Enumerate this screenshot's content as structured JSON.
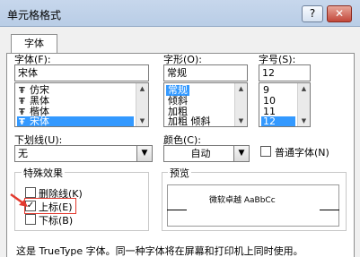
{
  "window": {
    "title": "单元格格式",
    "help_label": "?",
    "close_label": "✕"
  },
  "tabs": [
    {
      "label": "字体"
    }
  ],
  "font": {
    "label": "字体(F):",
    "value": "宋体",
    "items": [
      "仿宋",
      "黑体",
      "楷体",
      "宋体"
    ],
    "selected": "宋体",
    "icon_glyph": "Ŧ"
  },
  "style": {
    "label": "字形(O):",
    "value": "常规",
    "items": [
      "常规",
      "倾斜",
      "加粗",
      "加粗 倾斜"
    ],
    "selected": "常规"
  },
  "size": {
    "label": "字号(S):",
    "value": "12",
    "items": [
      "9",
      "10",
      "11",
      "12"
    ],
    "selected": "12"
  },
  "underline": {
    "label": "下划线(U):",
    "value": "无"
  },
  "color": {
    "label": "颜色(C):",
    "value": "自动"
  },
  "normal_font": {
    "label": "普通字体(N)",
    "checked": false
  },
  "effects": {
    "title": "特殊效果",
    "strikethrough": {
      "label": "删除线(K)",
      "checked": false
    },
    "superscript": {
      "label": "上标(E)",
      "checked": true
    },
    "subscript": {
      "label": "下标(B)",
      "checked": false
    }
  },
  "preview": {
    "title": "预览",
    "sample": "微软卓越  AaBbCc"
  },
  "footer_text": "这是 TrueType 字体。同一种字体将在屏幕和打印机上同时使用。",
  "colors": {
    "selection": "#3399ff",
    "annotation": "#e33a2f"
  },
  "icons": {
    "combo_arrow": "▼",
    "scroll_up": "▲",
    "scroll_down": "▼",
    "check_mark": "✓"
  }
}
